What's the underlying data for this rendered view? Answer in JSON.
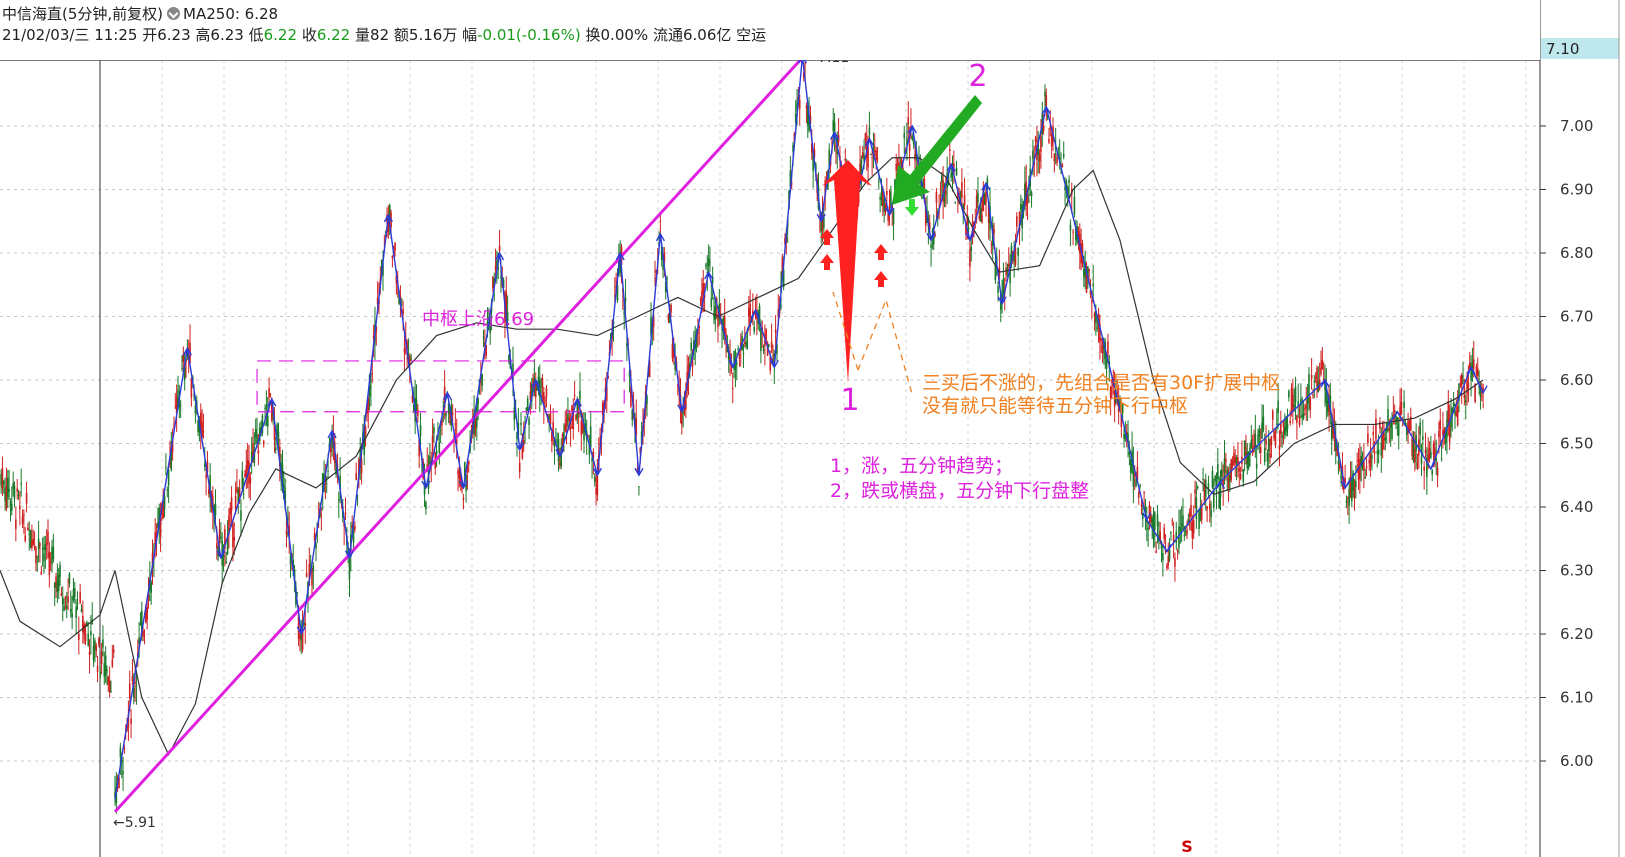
{
  "header": {
    "stock_name": "中信海直(5分钟,前复权)",
    "ma_label": "MA250: 6.28",
    "date_time": "21/02/03/三 11:25",
    "open_label": "开",
    "open_value": "6.23",
    "high_label": "高",
    "high_value": "6.23",
    "low_label": "低",
    "low_value": "6.22",
    "close_label": "收",
    "close_value": "6.22",
    "volume_label": "量",
    "volume_value": "82",
    "amount_label": "额",
    "amount_value": "5.16万",
    "change_label": "幅",
    "change_value": "-0.01(-0.16%)",
    "turnover_label": "换",
    "turnover_value": "0.00%",
    "float_label": "流通",
    "float_value": "6.06亿",
    "status": "空运"
  },
  "colors": {
    "bi_stroke": "#2a3bd6",
    "trendline": "#e020e0",
    "ma_line": "#333333",
    "candle_up": "#d02020",
    "candle_down": "#1a7a2a",
    "annotation_magenta": "#dd22dd",
    "annotation_orange": "#f08020",
    "arrow_red": "#ff2020",
    "arrow_green": "#22aa22",
    "price_label_bg": "#bfe8ec"
  },
  "chart_data": {
    "type": "candlestick",
    "yaxis_ticks": [
      "7.00",
      "6.90",
      "6.80",
      "6.70",
      "6.60",
      "6.50",
      "6.40",
      "6.30",
      "6.20",
      "6.10",
      "6.00"
    ],
    "ylim": [
      5.89,
      7.11
    ],
    "current_price_label": "7.10",
    "high_marker": "7.11",
    "low_marker": "5.91",
    "grid": true,
    "bi_points": [
      [
        0,
        5.94
      ],
      [
        54,
        6.65
      ],
      [
        79,
        6.32
      ],
      [
        117,
        6.57
      ],
      [
        139,
        6.2
      ],
      [
        162,
        6.52
      ],
      [
        175,
        6.32
      ],
      [
        204,
        6.86
      ],
      [
        232,
        6.43
      ],
      [
        248,
        6.58
      ],
      [
        260,
        6.43
      ],
      [
        287,
        6.8
      ],
      [
        302,
        6.49
      ],
      [
        314,
        6.6
      ],
      [
        332,
        6.48
      ],
      [
        345,
        6.57
      ],
      [
        360,
        6.45
      ],
      [
        377,
        6.8
      ],
      [
        391,
        6.45
      ],
      [
        407,
        6.83
      ],
      [
        423,
        6.55
      ],
      [
        443,
        6.77
      ],
      [
        461,
        6.62
      ],
      [
        478,
        6.71
      ],
      [
        492,
        6.62
      ],
      [
        513,
        7.11
      ],
      [
        527,
        6.85
      ],
      [
        537,
        6.99
      ],
      [
        550,
        6.85
      ],
      [
        563,
        6.98
      ],
      [
        578,
        6.86
      ],
      [
        595,
        7.0
      ],
      [
        609,
        6.82
      ],
      [
        624,
        6.94
      ],
      [
        638,
        6.82
      ],
      [
        650,
        6.91
      ],
      [
        662,
        6.72
      ],
      [
        695,
        7.03
      ],
      [
        770,
        6.38
      ],
      [
        785,
        6.33
      ],
      [
        825,
        6.44
      ],
      [
        903,
        6.6
      ],
      [
        918,
        6.43
      ],
      [
        957,
        6.55
      ],
      [
        982,
        6.46
      ],
      [
        1012,
        6.62
      ],
      [
        1021,
        6.58
      ]
    ],
    "ma_points": [
      [
        0,
        6.3
      ],
      [
        20,
        6.1
      ],
      [
        40,
        6.01
      ],
      [
        60,
        6.09
      ],
      [
        80,
        6.28
      ],
      [
        100,
        6.39
      ],
      [
        120,
        6.46
      ],
      [
        150,
        6.43
      ],
      [
        180,
        6.48
      ],
      [
        210,
        6.6
      ],
      [
        240,
        6.67
      ],
      [
        270,
        6.69
      ],
      [
        300,
        6.68
      ],
      [
        330,
        6.68
      ],
      [
        360,
        6.67
      ],
      [
        390,
        6.7
      ],
      [
        420,
        6.73
      ],
      [
        450,
        6.7
      ],
      [
        480,
        6.73
      ],
      [
        510,
        6.76
      ],
      [
        540,
        6.85
      ],
      [
        560,
        6.91
      ],
      [
        580,
        6.95
      ],
      [
        600,
        6.95
      ],
      [
        620,
        6.92
      ],
      [
        640,
        6.84
      ],
      [
        660,
        6.77
      ],
      [
        690,
        6.78
      ],
      [
        715,
        6.9
      ],
      [
        730,
        6.93
      ],
      [
        750,
        6.82
      ],
      [
        775,
        6.6
      ],
      [
        795,
        6.47
      ],
      [
        820,
        6.42
      ],
      [
        850,
        6.44
      ],
      [
        880,
        6.5
      ],
      [
        910,
        6.53
      ],
      [
        940,
        6.53
      ],
      [
        970,
        6.54
      ],
      [
        1000,
        6.57
      ],
      [
        1021,
        6.6
      ]
    ],
    "trendline": [
      [
        0,
        5.92
      ],
      [
        514,
        7.11
      ]
    ],
    "pivot_box": {
      "x_start": 106,
      "x_end": 380,
      "upper": 6.63,
      "lower": 6.55
    },
    "pivot_label": "中枢上沿6.69",
    "marker_s": "S",
    "annotation_1": "1",
    "annotation_2": "2",
    "note_lines": [
      "三买后不涨的，先组合是否有30F扩展中枢",
      "没有就只能等待五分钟下行中枢"
    ],
    "summary_lines": [
      "1，涨，五分钟趋势；",
      "2，跌或横盘，五分钟下行盘整"
    ]
  }
}
